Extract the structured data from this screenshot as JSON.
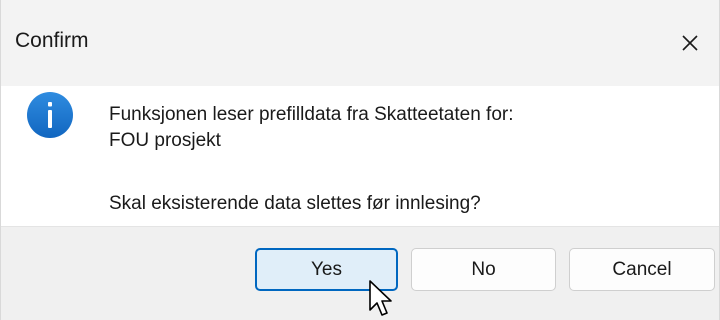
{
  "window": {
    "title": "Confirm",
    "close_icon": "close-icon"
  },
  "message": {
    "icon": "info-icon",
    "line1": "Funksjonen leser prefilldata fra Skatteetaten for:",
    "line2": "FOU prosjekt",
    "question": "Skal eksisterende data slettes før innlesing?"
  },
  "buttons": {
    "yes": "Yes",
    "no": "No",
    "cancel": "Cancel"
  },
  "colors": {
    "accent": "#0067c0",
    "info_icon": "#1a73c9",
    "titlebar_bg": "#f3f3f3",
    "footer_bg": "#f0f0f0"
  }
}
